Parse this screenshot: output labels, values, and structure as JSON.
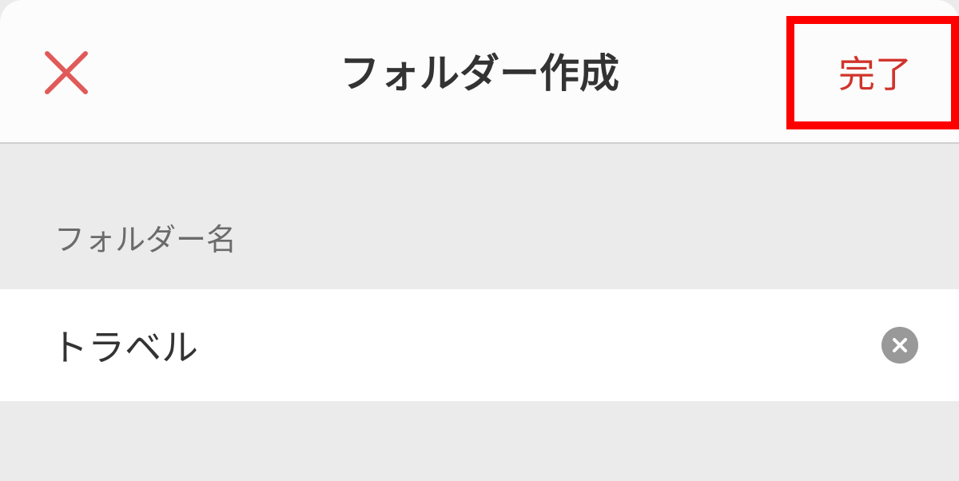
{
  "header": {
    "title": "フォルダー作成",
    "close_icon": "close-x-icon",
    "done_label": "完了"
  },
  "form": {
    "folder_name_label": "フォルダー名",
    "folder_name_value": "トラベル",
    "clear_icon": "clear-circle-x-icon"
  },
  "colors": {
    "accent": "#d0342c",
    "close_icon": "#e05a5a",
    "highlight": "#ff0000",
    "header_bg": "#fcfcfc",
    "page_bg": "#ebebeb",
    "clear_icon_bg": "#999999"
  }
}
